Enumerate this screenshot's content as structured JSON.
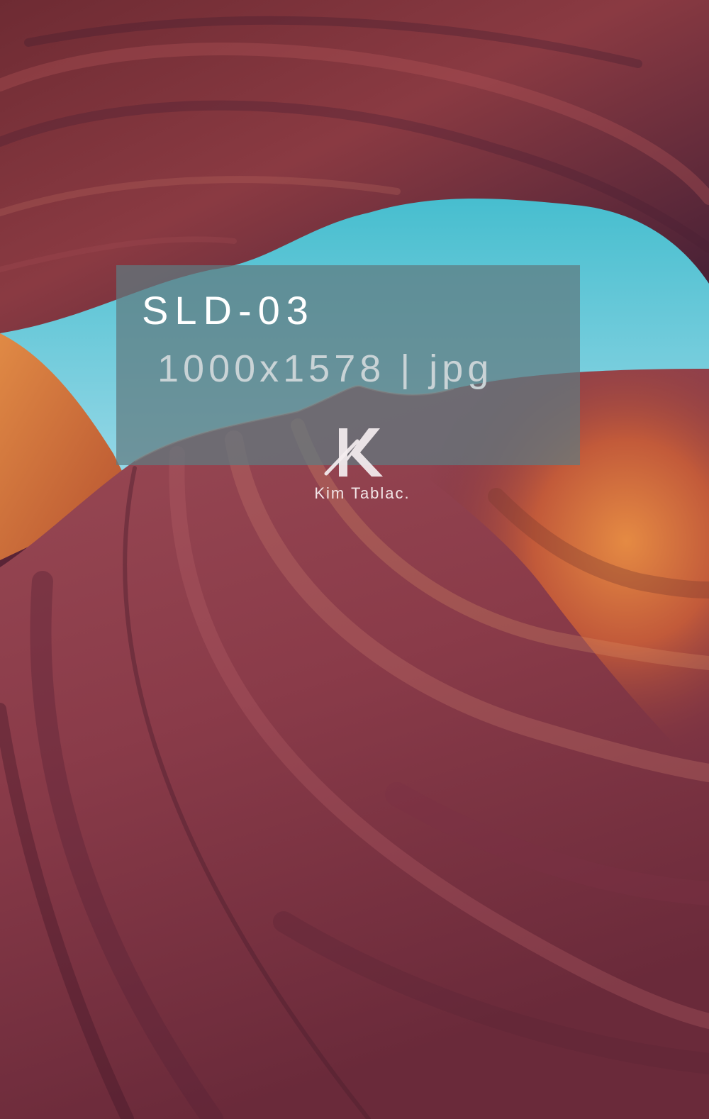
{
  "watermark": {
    "title": "SLD-03",
    "meta": "1000x1578 | jpg",
    "logo_letter": "K",
    "logo_name": "Kim Tablac."
  },
  "colors": {
    "sky_top": "#4ec4d4",
    "sky_bottom": "#8fd6e6",
    "rock_dark": "#5a2436",
    "rock_mid": "#a94a4a",
    "rock_warm": "#d9703a",
    "panel": "#607a80"
  }
}
